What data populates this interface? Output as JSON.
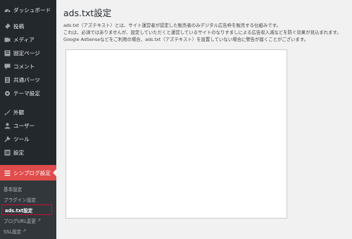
{
  "sidebar": {
    "dashboard": "ダッシュボード",
    "items": [
      {
        "label": "投稿"
      },
      {
        "label": "メディア"
      },
      {
        "label": "固定ページ"
      },
      {
        "label": "コメント"
      },
      {
        "label": "共通パーツ"
      },
      {
        "label": "テーマ設定"
      }
    ],
    "items2": [
      {
        "label": "外観"
      },
      {
        "label": "ユーザー"
      },
      {
        "label": "ツール"
      },
      {
        "label": "設定"
      }
    ],
    "active": "シンプログ設定",
    "submenu": [
      {
        "label": "基本設定"
      },
      {
        "label": "プラグイン設定"
      },
      {
        "label": "ads.txt設定"
      },
      {
        "label": "ブログURL変更"
      },
      {
        "label": "SSL設定"
      }
    ]
  },
  "main": {
    "title": "ads.txt設定",
    "desc": [
      "ads.txt（アズテキスト）とは、サイト運営者が認定した販売者のみデジタル広告枠を販売する仕組みです。",
      "これは、必須ではありませんが、設定していただくと運営しているサイトのなりすましによる広告収入減などを防ぐ効果が見込まれます。",
      "Google AdSenseなどをご利用の場合、ads.txt（アズテキスト）を設置していない場合に警告が届くことがございます。"
    ]
  }
}
